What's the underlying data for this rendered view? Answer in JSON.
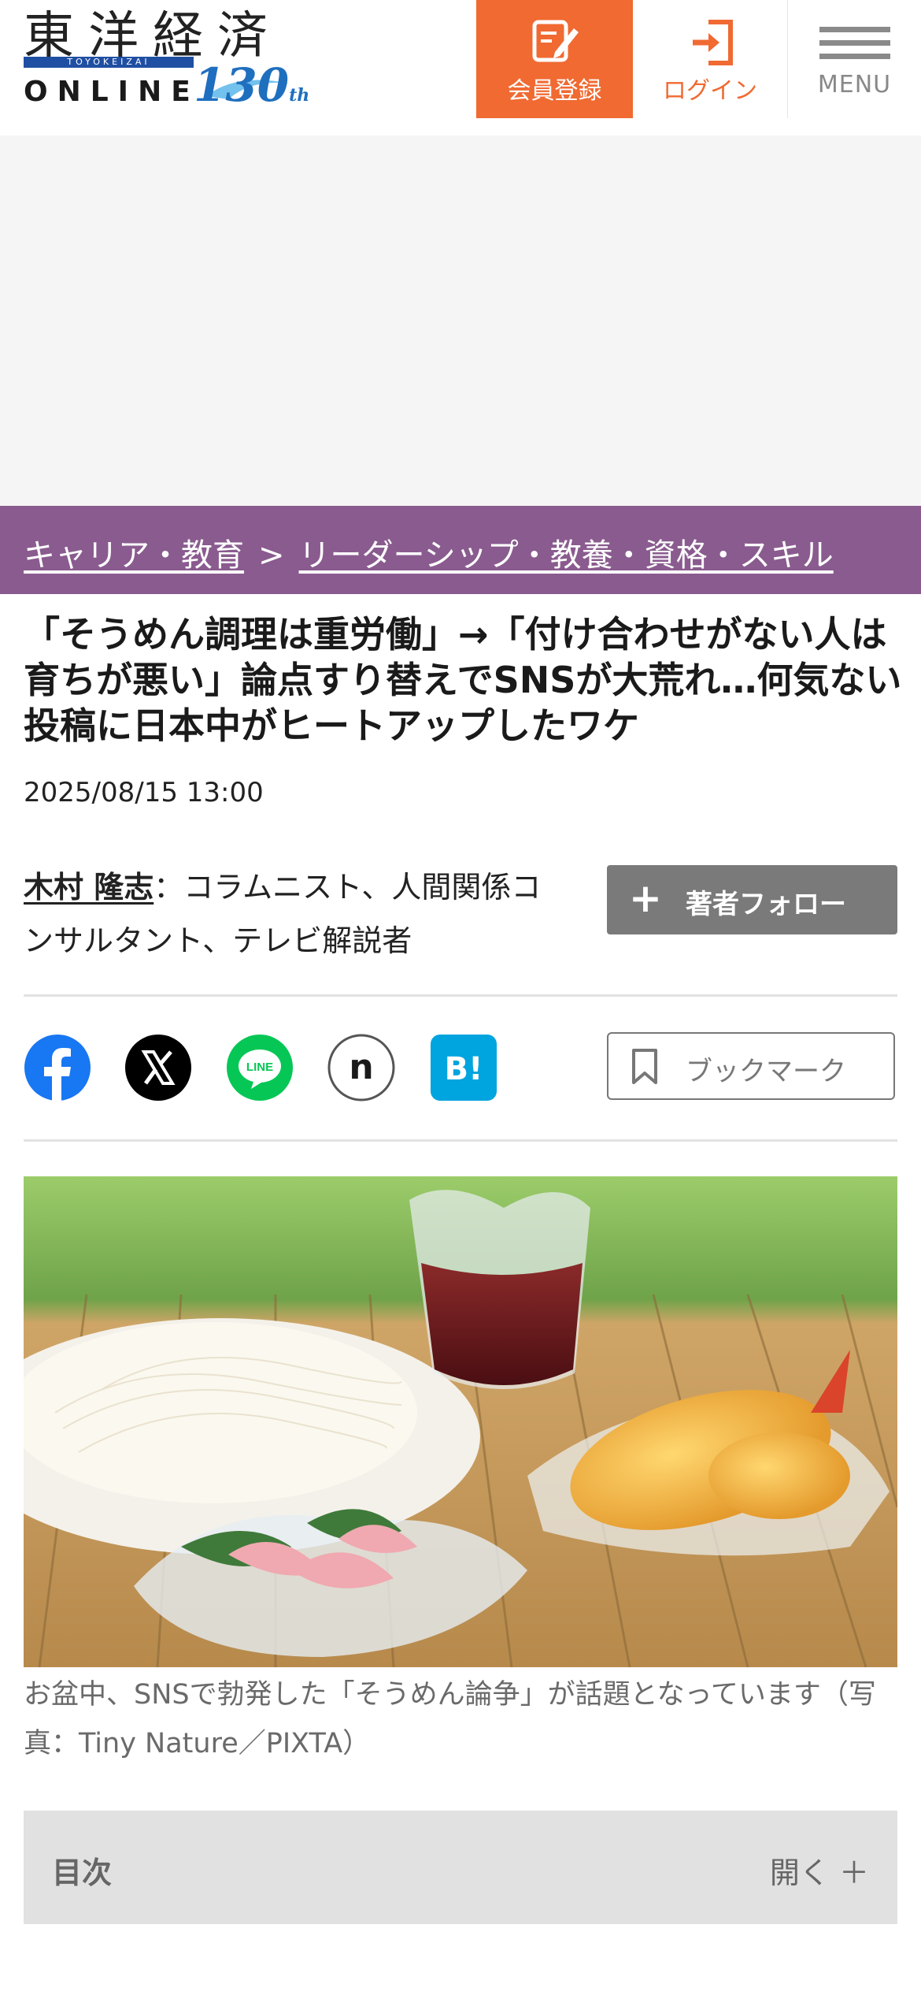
{
  "header": {
    "logo": {
      "title": "東洋経済",
      "bar_text": "TOYOKEIZAI",
      "online": "ONLINE",
      "anniversary": "130",
      "anniversary_suffix": "th"
    },
    "register_label": "会員登録",
    "login_label": "ログイン",
    "menu_label": "MENU",
    "accent_color": "#f06a32"
  },
  "breadcrumb": {
    "category": "キャリア・教育",
    "separator": ">",
    "subcategory": "リーダーシップ・教養・資格・スキル",
    "background_color": "#8a5b8f"
  },
  "article": {
    "title": "「そうめん調理は重労働」→「付け合わせがない人は育ちが悪い」論点すり替えでSNSが大荒れ…何気ない投稿に日本中がヒートアップしたワケ",
    "date": "2025/08/15 13:00",
    "author_name": "木村 隆志",
    "author_separator": "：",
    "author_role": "コラムニスト、人間関係コンサルタント、テレビ解説者",
    "follow_label": "著者フォロー",
    "bookmark_label": "ブックマーク",
    "photo_caption": "お盆中、SNSで勃発した「そうめん論争」が話題となっています（写真：Tiny Nature／PIXTA）"
  },
  "share": {
    "icons": [
      "facebook-icon",
      "x-icon",
      "line-icon",
      "note-icon",
      "hatena-bookmark-icon"
    ],
    "line_text": "LINE",
    "note_text": "n",
    "hatena_text": "B!"
  },
  "toc": {
    "label": "目次",
    "open_label": "開く ＋"
  }
}
